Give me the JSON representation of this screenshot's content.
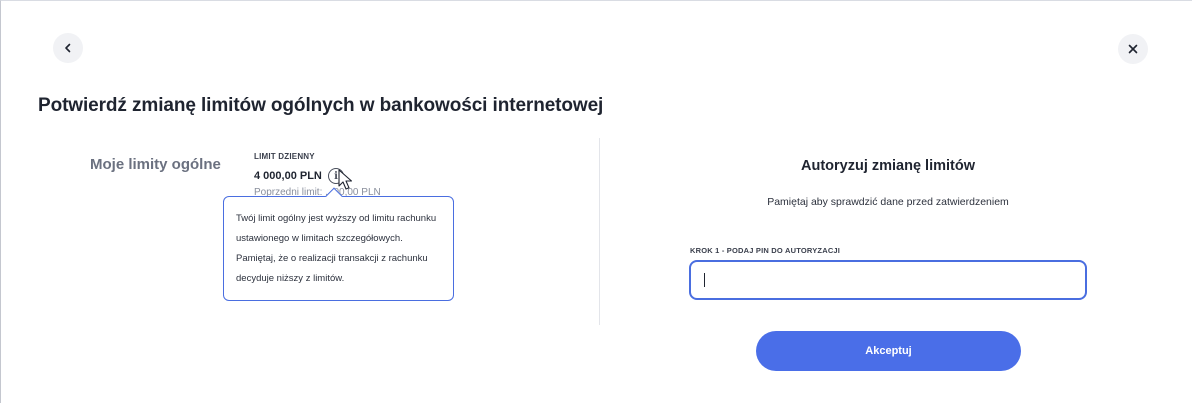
{
  "navigation": {
    "back_icon": "chevron-left-icon",
    "close_icon": "close-icon"
  },
  "page": {
    "title": "Potwierdź zmianę limitów ogólnych w bankowości internetowej"
  },
  "limits": {
    "section_label": "Moje limity ogólne",
    "daily_caption": "LIMIT DZIENNY",
    "daily_value": "4 000,00 PLN",
    "info_icon": "info-icon",
    "info_symbol": "i",
    "hidden_line": "Poprzedni limit: ...00,00 PLN",
    "tooltip_text": "Twój limit ogólny jest wyższy od limitu rachunku ustawionego w limitach szczegółowych. Pamiętaj, że o realizacji transakcji z rachunku decyduje niższy z limitów."
  },
  "authorization": {
    "title": "Autoryzuj zmianę limitów",
    "subtitle": "Pamiętaj aby sprawdzić dane przed zatwierdzeniem",
    "step_label": "KROK 1 - PODAJ PIN DO AUTORYZACJI",
    "pin_value": "",
    "accept_label": "Akceptuj"
  },
  "colors": {
    "accent": "#4a6ee8",
    "border_focus": "#4a6ee0",
    "text_primary": "#1f2430",
    "text_muted": "#6b7180"
  }
}
